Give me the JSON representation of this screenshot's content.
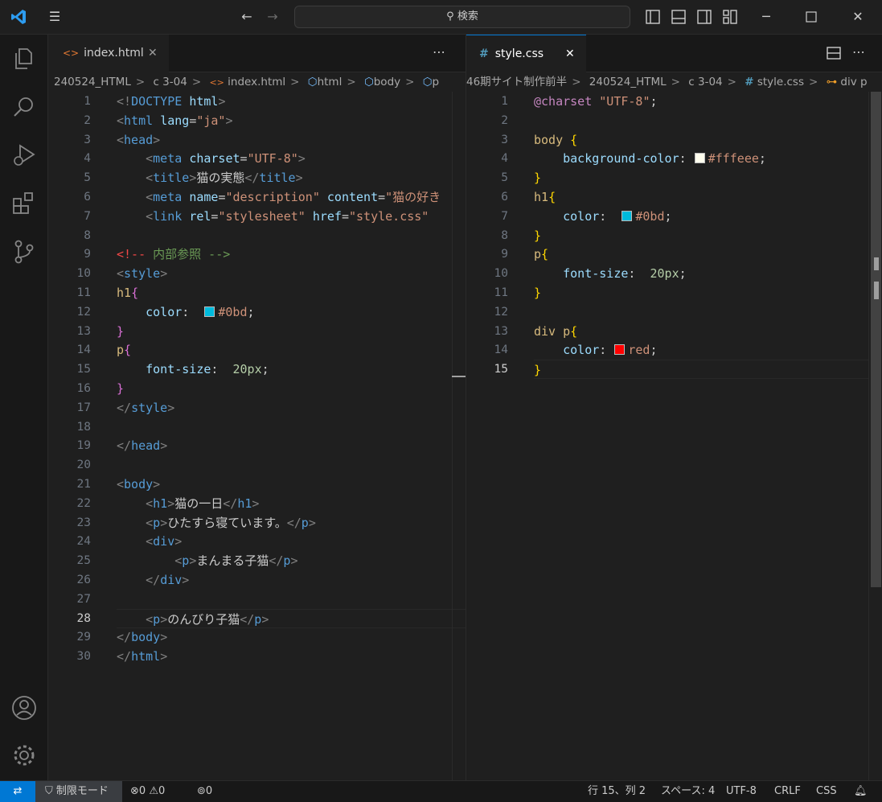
{
  "titlebar": {
    "search_label": "検索"
  },
  "left_editor": {
    "tab_label": "index.html",
    "breadcrumbs": [
      "240524_HTML",
      "c 3-04",
      "index.html",
      "html",
      "body",
      "p"
    ],
    "current_line": 28,
    "lines": [
      [
        [
          "c-br",
          "<!"
        ],
        [
          "c-tag",
          "DOCTYPE "
        ],
        [
          "c-attr",
          "html"
        ],
        [
          "c-br",
          ">"
        ]
      ],
      [
        [
          "c-br",
          "<"
        ],
        [
          "c-tag",
          "html "
        ],
        [
          "c-attr",
          "lang"
        ],
        [
          "c-txt",
          "="
        ],
        [
          "c-str",
          "\"ja\""
        ],
        [
          "c-br",
          ">"
        ]
      ],
      [
        [
          "c-br",
          "<"
        ],
        [
          "c-tag",
          "head"
        ],
        [
          "c-br",
          ">"
        ]
      ],
      [
        [
          "c-txt",
          "    "
        ],
        [
          "c-br",
          "<"
        ],
        [
          "c-tag",
          "meta "
        ],
        [
          "c-attr",
          "charset"
        ],
        [
          "c-txt",
          "="
        ],
        [
          "c-str",
          "\"UTF-8\""
        ],
        [
          "c-br",
          ">"
        ]
      ],
      [
        [
          "c-txt",
          "    "
        ],
        [
          "c-br",
          "<"
        ],
        [
          "c-tag",
          "title"
        ],
        [
          "c-br",
          ">"
        ],
        [
          "c-txt",
          "猫の実態"
        ],
        [
          "c-br",
          "</"
        ],
        [
          "c-tag",
          "title"
        ],
        [
          "c-br",
          ">"
        ]
      ],
      [
        [
          "c-txt",
          "    "
        ],
        [
          "c-br",
          "<"
        ],
        [
          "c-tag",
          "meta "
        ],
        [
          "c-attr",
          "name"
        ],
        [
          "c-txt",
          "="
        ],
        [
          "c-str",
          "\"description\" "
        ],
        [
          "c-attr",
          "content"
        ],
        [
          "c-txt",
          "="
        ],
        [
          "c-str",
          "\"猫の好き"
        ]
      ],
      [
        [
          "c-txt",
          "    "
        ],
        [
          "c-br",
          "<"
        ],
        [
          "c-tag",
          "link "
        ],
        [
          "c-attr",
          "rel"
        ],
        [
          "c-txt",
          "="
        ],
        [
          "c-str",
          "\"stylesheet\" "
        ],
        [
          "c-attr",
          "href"
        ],
        [
          "c-txt",
          "="
        ],
        [
          "c-str",
          "\"style.css\""
        ]
      ],
      [],
      [
        [
          "c-red",
          "<!--"
        ],
        [
          "c-com",
          " 内部参照 -->"
        ]
      ],
      [
        [
          "c-br",
          "<"
        ],
        [
          "c-tag",
          "style"
        ],
        [
          "c-br",
          ">"
        ]
      ],
      [
        [
          "c-sel",
          "h1"
        ],
        [
          "c-pink",
          "{"
        ]
      ],
      [
        [
          "c-txt",
          "    "
        ],
        [
          "c-prop",
          "color"
        ],
        [
          "c-txt",
          ":  "
        ],
        [
          "sw",
          "#00bbdd"
        ],
        [
          "c-val",
          "#0bd"
        ],
        [
          "c-txt",
          ";"
        ]
      ],
      [
        [
          "c-pink",
          "}"
        ]
      ],
      [
        [
          "c-sel",
          "p"
        ],
        [
          "c-pink",
          "{"
        ]
      ],
      [
        [
          "c-txt",
          "    "
        ],
        [
          "c-prop",
          "font-size"
        ],
        [
          "c-txt",
          ":  "
        ],
        [
          "c-num",
          "20px"
        ],
        [
          "c-txt",
          ";"
        ]
      ],
      [
        [
          "c-pink",
          "}"
        ]
      ],
      [
        [
          "c-br",
          "</"
        ],
        [
          "c-tag",
          "style"
        ],
        [
          "c-br",
          ">"
        ]
      ],
      [],
      [
        [
          "c-br",
          "</"
        ],
        [
          "c-tag",
          "head"
        ],
        [
          "c-br",
          ">"
        ]
      ],
      [],
      [
        [
          "c-br",
          "<"
        ],
        [
          "c-tag",
          "body"
        ],
        [
          "c-br",
          ">"
        ]
      ],
      [
        [
          "c-txt",
          "    "
        ],
        [
          "c-br",
          "<"
        ],
        [
          "c-tag",
          "h1"
        ],
        [
          "c-br",
          ">"
        ],
        [
          "c-txt",
          "猫の一日"
        ],
        [
          "c-br",
          "</"
        ],
        [
          "c-tag",
          "h1"
        ],
        [
          "c-br",
          ">"
        ]
      ],
      [
        [
          "c-txt",
          "    "
        ],
        [
          "c-br",
          "<"
        ],
        [
          "c-tag",
          "p"
        ],
        [
          "c-br",
          ">"
        ],
        [
          "c-txt",
          "ひたすら寝ています。"
        ],
        [
          "c-br",
          "</"
        ],
        [
          "c-tag",
          "p"
        ],
        [
          "c-br",
          ">"
        ]
      ],
      [
        [
          "c-txt",
          "    "
        ],
        [
          "c-br",
          "<"
        ],
        [
          "c-tag",
          "div"
        ],
        [
          "c-br",
          ">"
        ]
      ],
      [
        [
          "c-txt",
          "        "
        ],
        [
          "c-br",
          "<"
        ],
        [
          "c-tag",
          "p"
        ],
        [
          "c-br",
          ">"
        ],
        [
          "c-txt",
          "まんまる子猫"
        ],
        [
          "c-br",
          "</"
        ],
        [
          "c-tag",
          "p"
        ],
        [
          "c-br",
          ">"
        ]
      ],
      [
        [
          "c-txt",
          "    "
        ],
        [
          "c-br",
          "</"
        ],
        [
          "c-tag",
          "div"
        ],
        [
          "c-br",
          ">"
        ]
      ],
      [],
      [
        [
          "c-txt",
          "    "
        ],
        [
          "c-br",
          "<"
        ],
        [
          "c-tag",
          "p"
        ],
        [
          "c-br",
          ">"
        ],
        [
          "c-txt",
          "のんびり子猫"
        ],
        [
          "c-br",
          "</"
        ],
        [
          "c-tag",
          "p"
        ],
        [
          "c-br",
          ">"
        ]
      ],
      [
        [
          "c-br",
          "</"
        ],
        [
          "c-tag",
          "body"
        ],
        [
          "c-br",
          ">"
        ]
      ],
      [
        [
          "c-br",
          "</"
        ],
        [
          "c-tag",
          "html"
        ],
        [
          "c-br",
          ">"
        ]
      ]
    ]
  },
  "right_editor": {
    "tab_label": "style.css",
    "breadcrumbs": [
      "46期サイト制作前半",
      "240524_HTML",
      "c 3-04",
      "style.css",
      "div p"
    ],
    "current_line": 15,
    "lines": [
      [
        [
          "c-at",
          "@charset "
        ],
        [
          "c-str",
          "\"UTF-8\""
        ],
        [
          "c-txt",
          ";"
        ]
      ],
      [],
      [
        [
          "c-sel",
          "body "
        ],
        [
          "c-gold",
          "{"
        ]
      ],
      [
        [
          "c-txt",
          "    "
        ],
        [
          "c-prop",
          "background-color"
        ],
        [
          "c-txt",
          ": "
        ],
        [
          "sw",
          "#fffeee"
        ],
        [
          "c-val",
          "#fffeee"
        ],
        [
          "c-txt",
          ";"
        ]
      ],
      [
        [
          "c-gold",
          "}"
        ]
      ],
      [
        [
          "c-sel",
          "h1"
        ],
        [
          "c-gold",
          "{"
        ]
      ],
      [
        [
          "c-txt",
          "    "
        ],
        [
          "c-prop",
          "color"
        ],
        [
          "c-txt",
          ":  "
        ],
        [
          "sw",
          "#00bbdd"
        ],
        [
          "c-val",
          "#0bd"
        ],
        [
          "c-txt",
          ";"
        ]
      ],
      [
        [
          "c-gold",
          "}"
        ]
      ],
      [
        [
          "c-sel",
          "p"
        ],
        [
          "c-gold",
          "{"
        ]
      ],
      [
        [
          "c-txt",
          "    "
        ],
        [
          "c-prop",
          "font-size"
        ],
        [
          "c-txt",
          ":  "
        ],
        [
          "c-num",
          "20px"
        ],
        [
          "c-txt",
          ";"
        ]
      ],
      [
        [
          "c-gold",
          "}"
        ]
      ],
      [],
      [
        [
          "c-sel",
          "div p"
        ],
        [
          "c-gold",
          "{"
        ]
      ],
      [
        [
          "c-txt",
          "    "
        ],
        [
          "c-prop",
          "color"
        ],
        [
          "c-txt",
          ": "
        ],
        [
          "sw",
          "#ff0000"
        ],
        [
          "c-val",
          "red"
        ],
        [
          "c-txt",
          ";"
        ]
      ],
      [
        [
          "c-gold",
          "}"
        ]
      ]
    ]
  },
  "statusbar": {
    "restricted_mode": "制限モード",
    "errors": "0",
    "warnings": "0",
    "ports": "0",
    "position": "行 15、列 2",
    "spaces": "スペース: 4",
    "encoding": "UTF-8",
    "eol": "CRLF",
    "language": "CSS"
  },
  "colors": {
    "accent": "#0078d4",
    "tab_close": "#cccccc"
  }
}
